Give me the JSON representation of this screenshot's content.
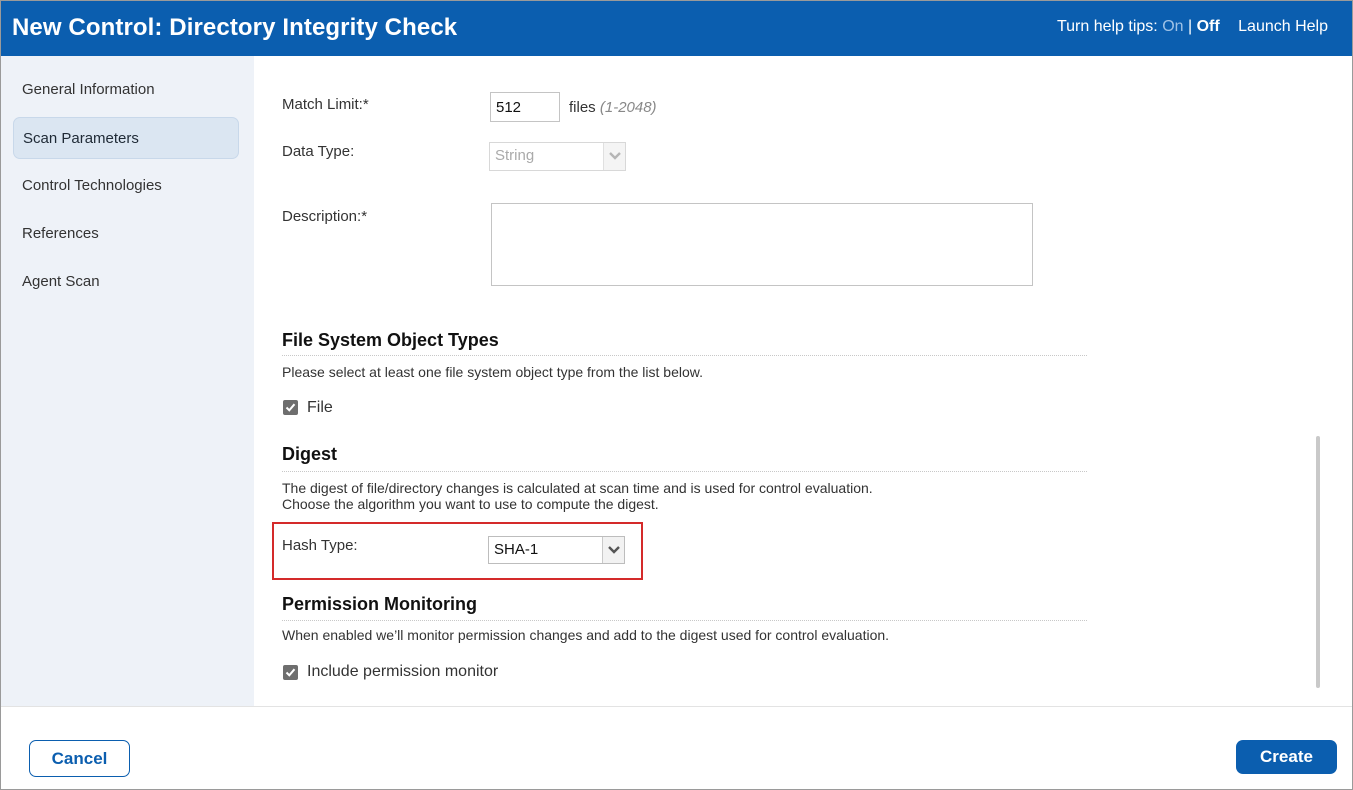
{
  "header": {
    "title": "New Control: Directory Integrity Check",
    "help_tips_label": "Turn help tips:",
    "help_on": "On",
    "separator": "|",
    "help_off": "Off",
    "launch_help": "Launch Help"
  },
  "sidebar": {
    "items": [
      {
        "label": "General Information",
        "active": false
      },
      {
        "label": "Scan Parameters",
        "active": true
      },
      {
        "label": "Control Technologies",
        "active": false
      },
      {
        "label": "References",
        "active": false
      },
      {
        "label": "Agent Scan",
        "active": false
      }
    ]
  },
  "form": {
    "match_limit": {
      "label": "Match Limit:*",
      "value": "512",
      "unit": "files",
      "range": "(1-2048)"
    },
    "data_type": {
      "label": "Data Type:",
      "value": "String"
    },
    "description": {
      "label": "Description:*",
      "value": ""
    }
  },
  "file_system": {
    "title": "File System Object Types",
    "text": "Please select at least one file system object type from the list below.",
    "file_label": "File",
    "file_checked": true
  },
  "digest": {
    "title": "Digest",
    "text_line1": "The digest of file/directory changes is calculated at scan time and is used for control evaluation.",
    "text_line2": "Choose the algorithm you want to use to compute the digest.",
    "hash_label": "Hash Type:",
    "hash_value": "SHA-1"
  },
  "permission": {
    "title": "Permission Monitoring",
    "text": "When enabled we’ll monitor permission changes and add to the digest used for control evaluation.",
    "include_label": "Include permission monitor",
    "include_checked": true
  },
  "footer": {
    "cancel_label": "Cancel",
    "create_label": "Create"
  },
  "colors": {
    "brand": "#0b5eaf",
    "highlight": "#d42a2a",
    "sidebar_bg": "#eef2f8"
  }
}
